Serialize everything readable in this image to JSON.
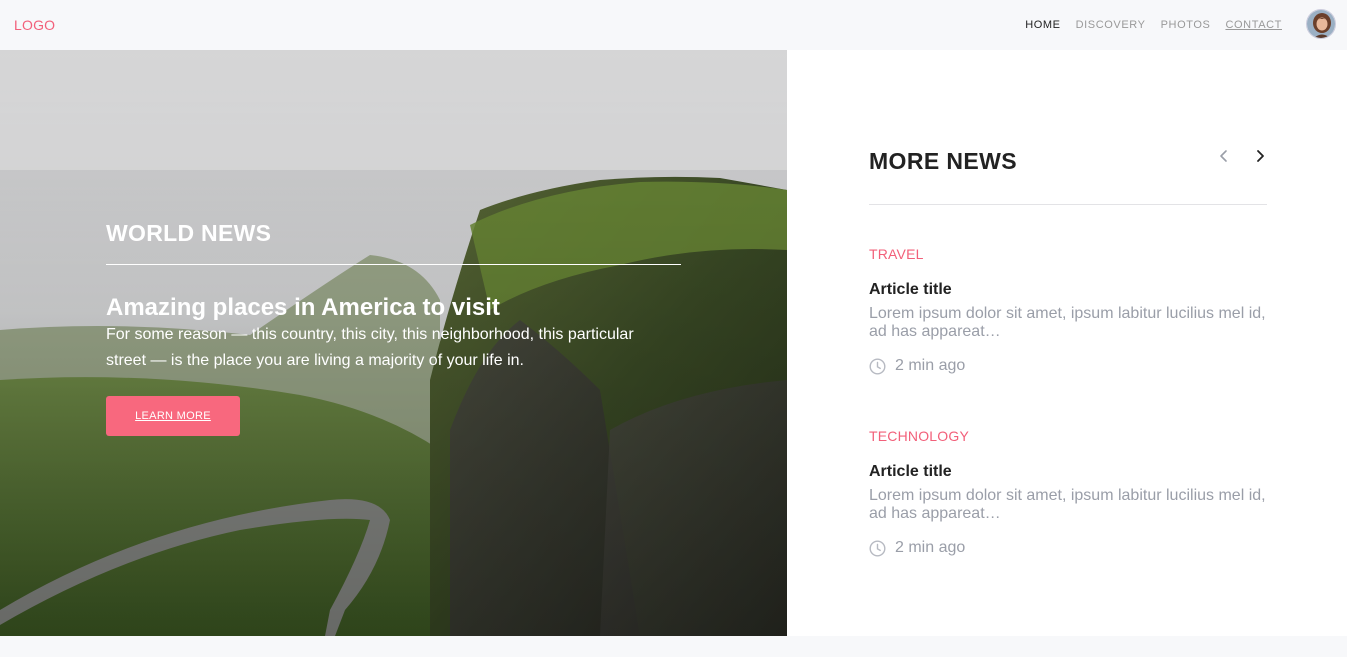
{
  "navbar": {
    "logo": "LOGO",
    "links": [
      {
        "label": "HOME",
        "state": "active"
      },
      {
        "label": "DISCOVERY",
        "state": "default"
      },
      {
        "label": "PHOTOS",
        "state": "default"
      },
      {
        "label": "CONTACT",
        "state": "underlined"
      }
    ],
    "avatar_icon": "user-avatar"
  },
  "hero": {
    "section": "WORLD NEWS",
    "title": "Amazing places in America to visit",
    "text": "For some reason — this country, this city, this neighborhood, this particular street — is the place you are living a majority of your life in.",
    "button_label": "LEARN MORE",
    "image_subject": "green cliffs with winding road under misty sky"
  },
  "more_news": {
    "title": "MORE NEWS",
    "prev_icon": "chevron-left-icon",
    "next_icon": "chevron-right-icon",
    "articles": [
      {
        "category": "TRAVEL",
        "title": "Article title",
        "excerpt": "Lorem ipsum dolor sit amet, ipsum labitur lucilius mel id, ad has appareat…",
        "time": "2 min ago"
      },
      {
        "category": "TECHNOLOGY",
        "title": "Article title",
        "excerpt": "Lorem ipsum dolor sit amet, ipsum labitur lucilius mel id, ad has appareat…",
        "time": "2 min ago"
      }
    ]
  },
  "colors": {
    "accent": "#f2607a",
    "button": "#f8687e",
    "muted_text": "#9a9ea8",
    "page_bg": "#f7f8fa"
  }
}
